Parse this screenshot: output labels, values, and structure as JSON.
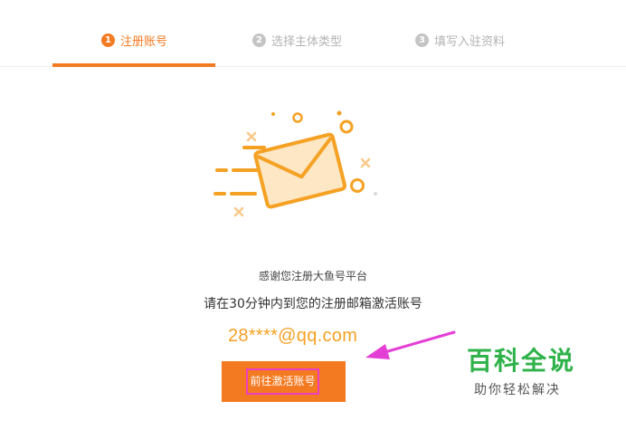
{
  "steps": [
    {
      "number": "1",
      "label": "注册账号",
      "active": true
    },
    {
      "number": "2",
      "label": "选择主体类型",
      "active": false
    },
    {
      "number": "3",
      "label": "填写入驻资料",
      "active": false
    }
  ],
  "illustration": {
    "icon": "envelope-icon"
  },
  "message": {
    "thanks": "感谢您注册大鱼号平台",
    "instruction": "请在30分钟内到您的注册邮箱激活账号",
    "email": "28****@qq.com"
  },
  "activate_button": {
    "label": "前往激活账号"
  },
  "watermark": {
    "title": "百科全说",
    "subtitle": "助你轻松解决"
  },
  "colors": {
    "accent": "#f47a22",
    "email": "#f5a123",
    "highlight": "#ec3fbf",
    "watermark": "#2fb24a",
    "inactive": "#b3b3b3"
  }
}
